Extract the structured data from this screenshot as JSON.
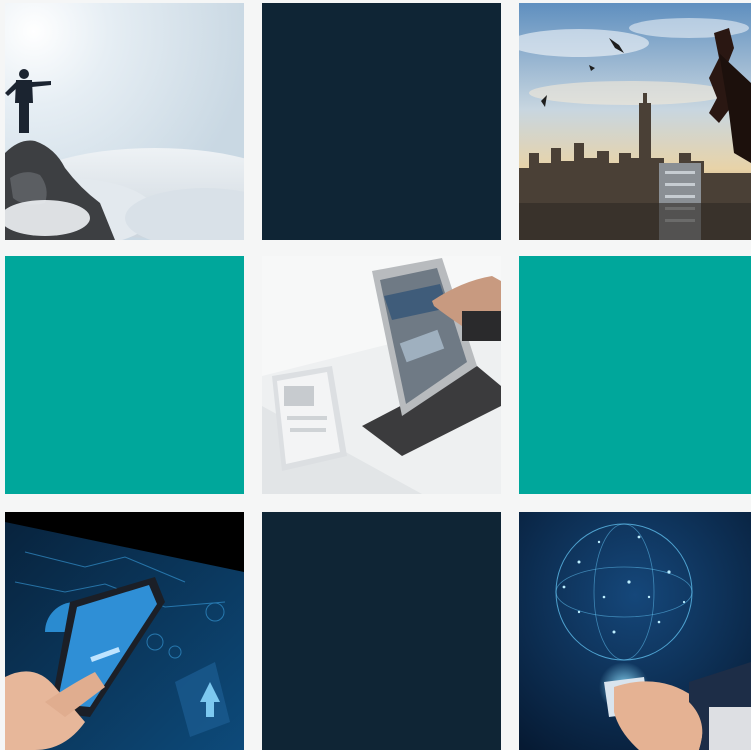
{
  "grid": {
    "tiles": [
      {
        "kind": "photo",
        "subject": "man-on-mountain-above-clouds"
      },
      {
        "kind": "solid",
        "color": "#0f2535"
      },
      {
        "kind": "photo",
        "subject": "city-skyline-climber"
      },
      {
        "kind": "solid",
        "color": "#00a79b"
      },
      {
        "kind": "photo",
        "subject": "tablet-on-desk"
      },
      {
        "kind": "solid",
        "color": "#00a79b"
      },
      {
        "kind": "photo",
        "subject": "smartphone-with-data-hologram"
      },
      {
        "kind": "solid",
        "color": "#0f2535"
      },
      {
        "kind": "photo",
        "subject": "hand-with-digital-globe"
      }
    ]
  },
  "colors": {
    "navy": "#0f2535",
    "teal": "#00a79b",
    "background": "#f5f6f6"
  }
}
